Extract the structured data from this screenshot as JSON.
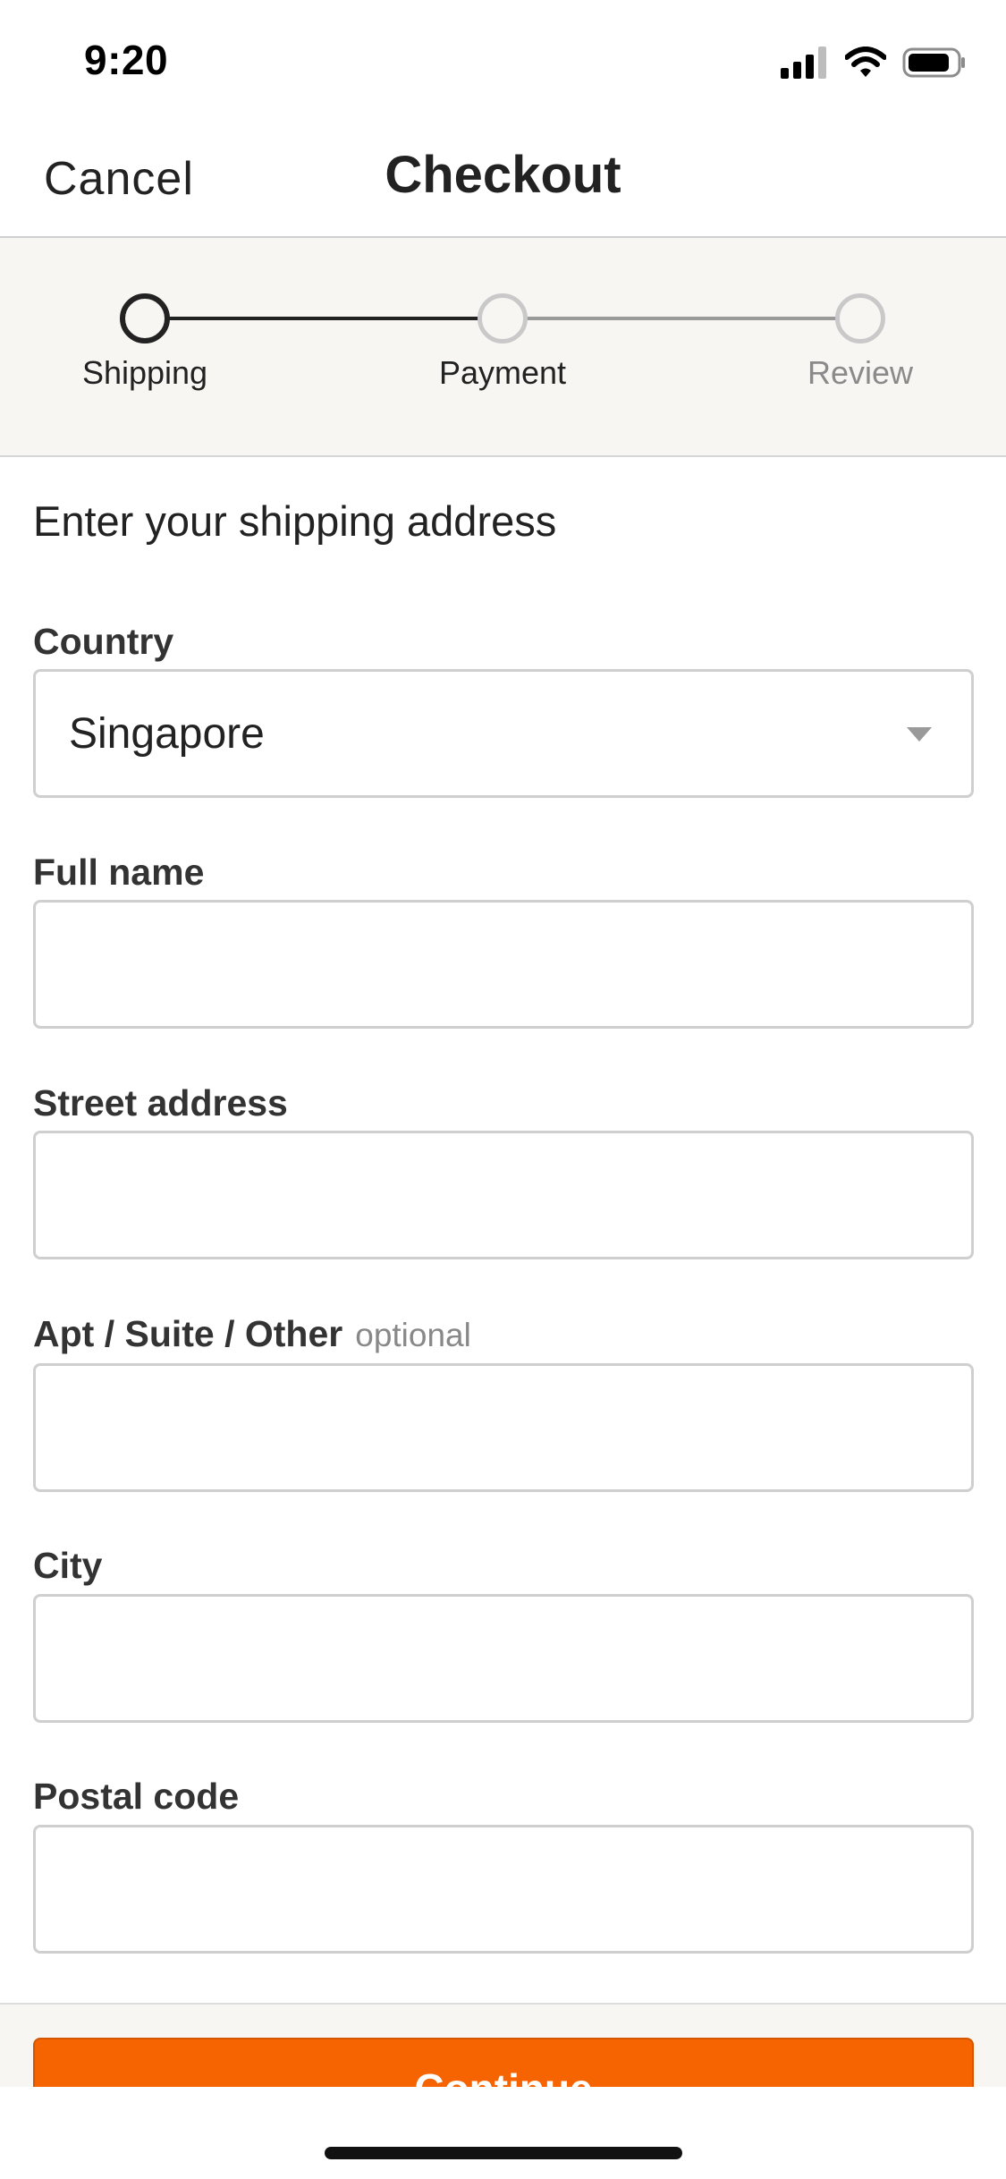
{
  "status_bar": {
    "time": "9:20",
    "icons": [
      "cellular-signal-icon",
      "wifi-icon",
      "battery-icon"
    ]
  },
  "header": {
    "cancel_label": "Cancel",
    "title": "Checkout"
  },
  "stepper": {
    "steps": [
      {
        "label": "Shipping",
        "state": "current"
      },
      {
        "label": "Payment",
        "state": "upcoming"
      },
      {
        "label": "Review",
        "state": "upcoming"
      }
    ]
  },
  "form": {
    "heading": "Enter your shipping address",
    "country": {
      "label": "Country",
      "value": "Singapore"
    },
    "full_name": {
      "label": "Full name",
      "value": ""
    },
    "street_address": {
      "label": "Street address",
      "value": ""
    },
    "apt": {
      "label": "Apt / Suite / Other",
      "optional_tag": "optional",
      "value": ""
    },
    "city": {
      "label": "City",
      "value": ""
    },
    "postal_code": {
      "label": "Postal code",
      "value": ""
    }
  },
  "footer": {
    "continue_label": "Continue"
  },
  "colors": {
    "accent": "#f56400",
    "stepper_bg": "#f7f6f2",
    "active_step": "#222222",
    "inactive_step": "#c9c9c9"
  }
}
